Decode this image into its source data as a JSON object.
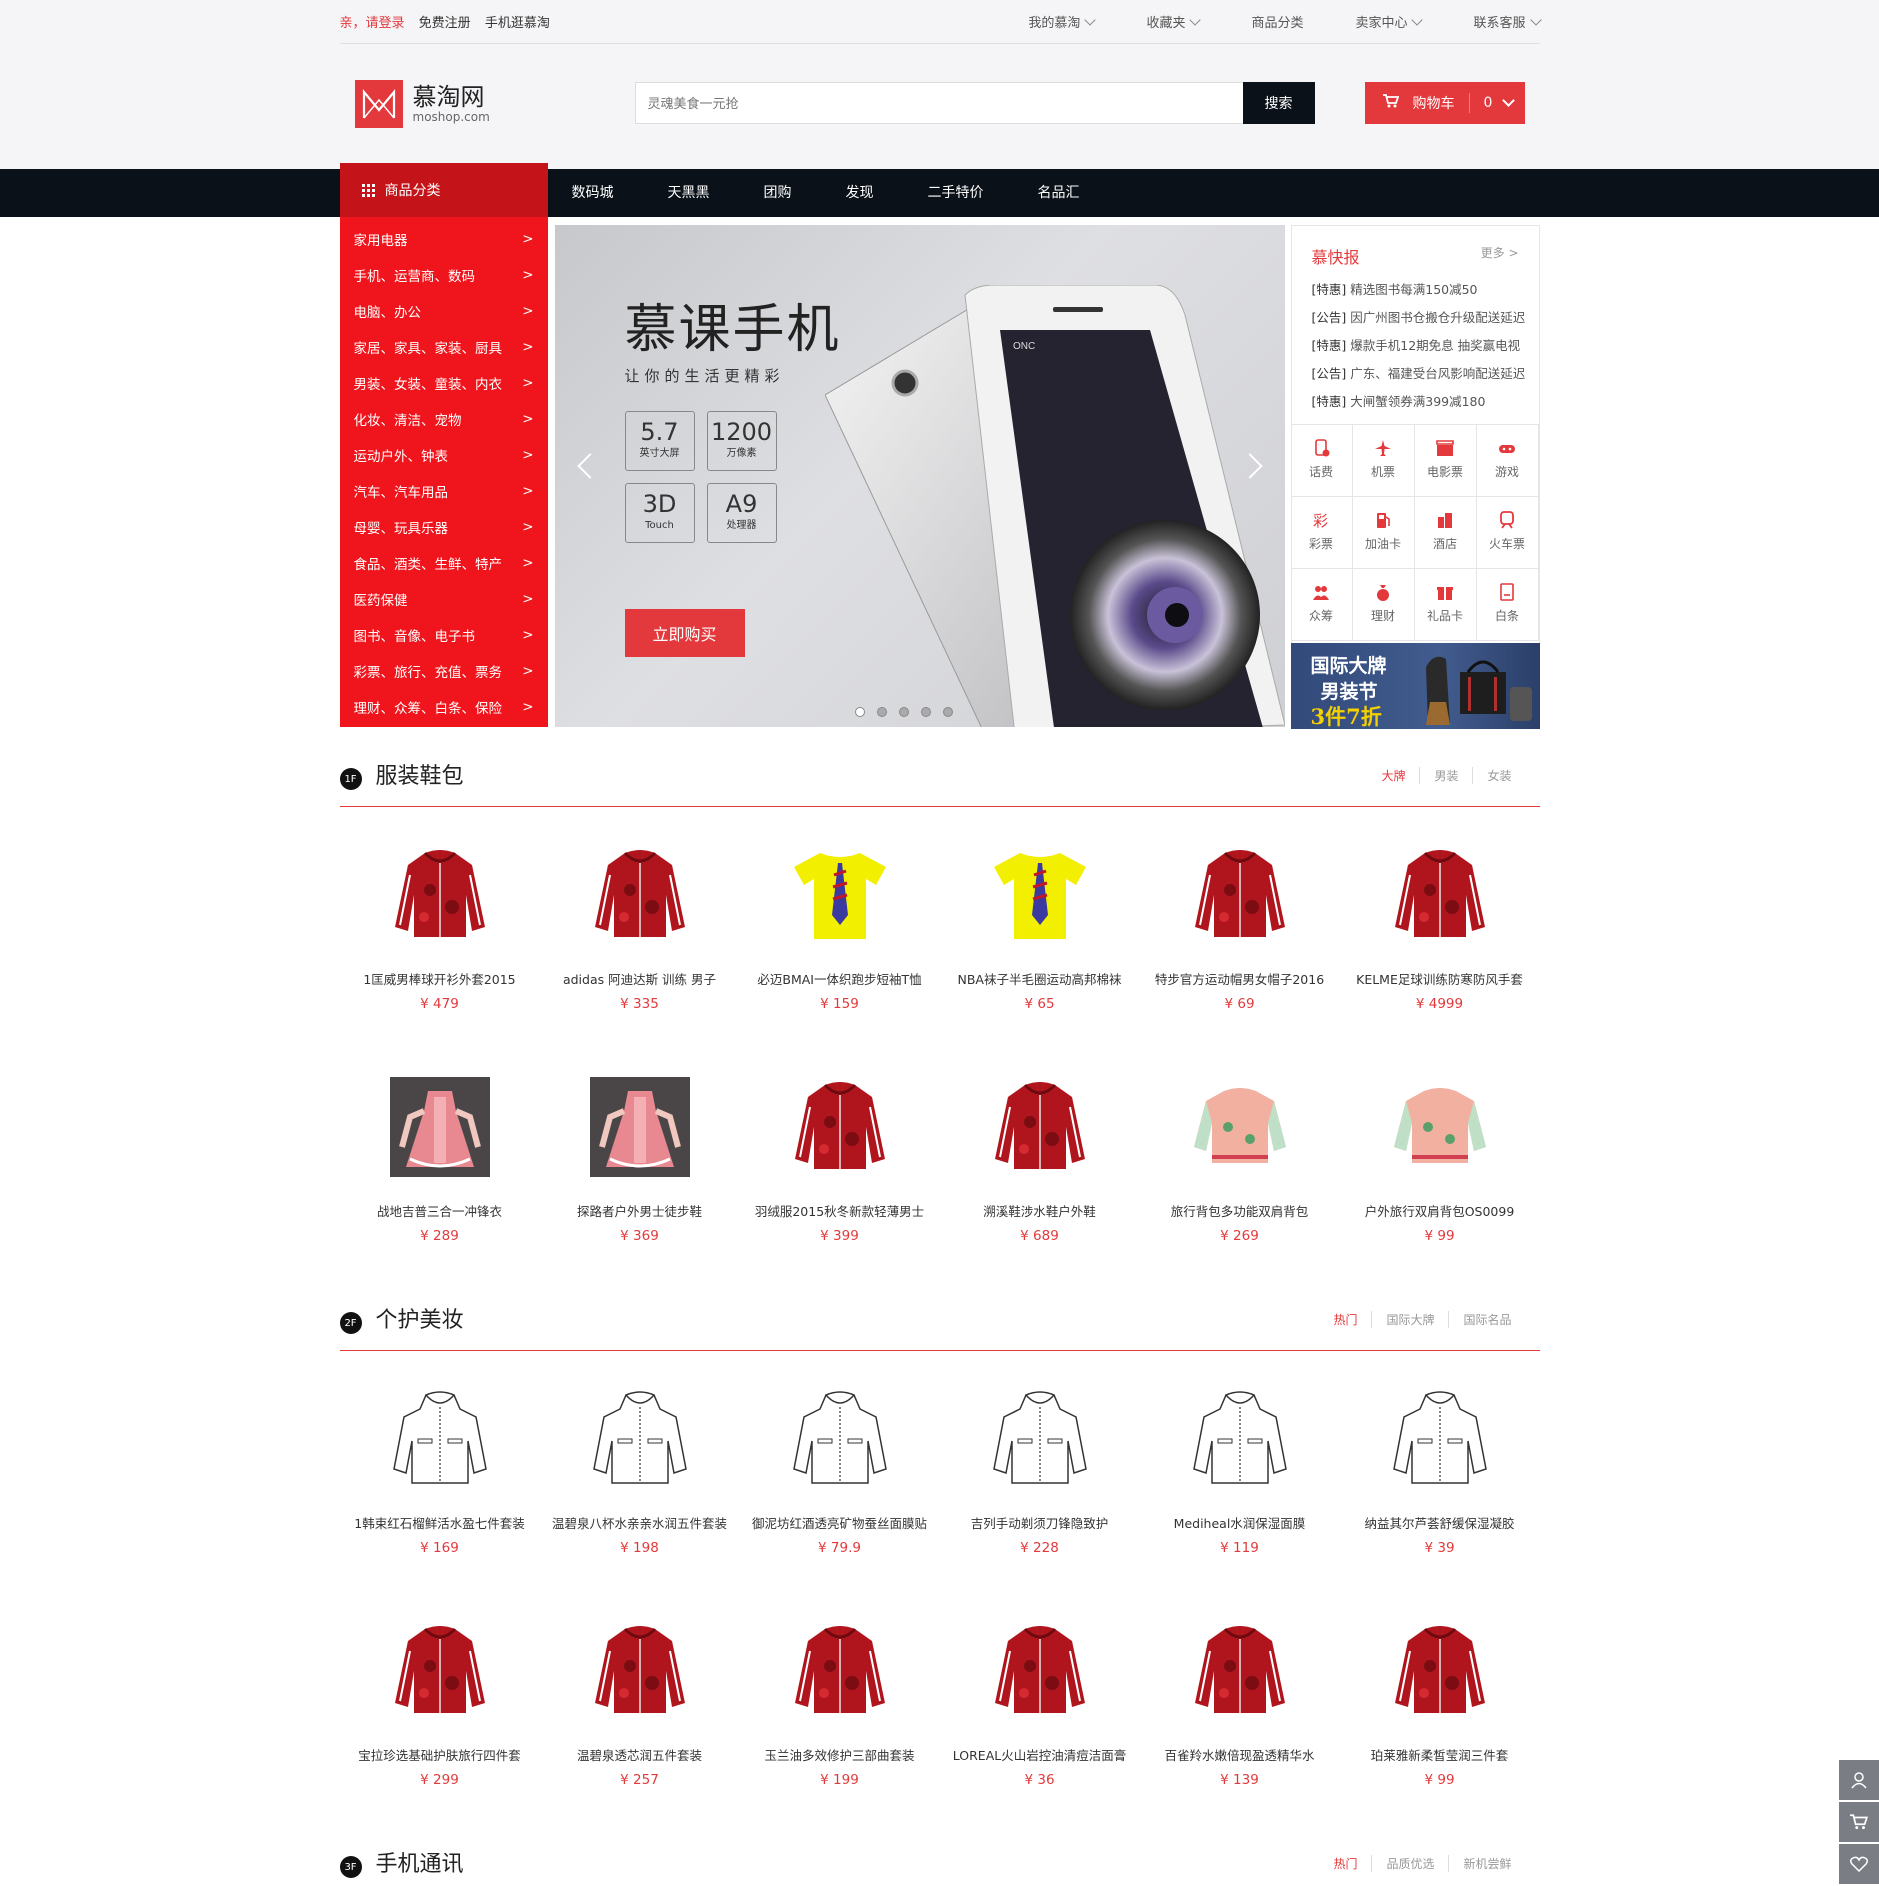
{
  "topbar": {
    "greeting": "亲，请登录",
    "register": "免费注册",
    "mobile": "手机逛慕淘",
    "links": [
      "我的慕淘",
      "收藏夹",
      "商品分类",
      "卖家中心",
      "联系客服"
    ]
  },
  "logo": {
    "cn": "慕淘网",
    "en": "moshop.com"
  },
  "search": {
    "placeholder": "灵魂美食一元抢",
    "button": "搜索"
  },
  "cart": {
    "label": "购物车",
    "count": "0"
  },
  "nav": {
    "category_label": "商品分类",
    "items": [
      "数码城",
      "天黑黑",
      "团购",
      "发现",
      "二手特价",
      "名品汇"
    ]
  },
  "categories": [
    "家用电器",
    "手机、运营商、数码",
    "电脑、办公",
    "家居、家具、家装、厨具",
    "男装、女装、童装、内衣",
    "化妆、清洁、宠物",
    "运动户外、钟表",
    "汽车、汽车用品",
    "母婴、玩具乐器",
    "食品、酒类、生鲜、特产",
    "医药保健",
    "图书、音像、电子书",
    "彩票、旅行、充值、票务",
    "理财、众筹、白条、保险"
  ],
  "category_arrow": ">",
  "banner": {
    "title": "慕课手机",
    "subtitle": "让你的生活更精彩",
    "specs": [
      {
        "big": "5.7",
        "small": "英寸大屏"
      },
      {
        "big": "1200",
        "small": "万像素"
      },
      {
        "big": "3D",
        "small": "Touch"
      },
      {
        "big": "A9",
        "small": "处理器"
      }
    ],
    "button": "立即购买",
    "phone_brand": "ONC",
    "active_dot": 1,
    "dot_count": 5
  },
  "news": {
    "title": "慕快报",
    "more": "更多 >",
    "items": [
      {
        "tag": "[特惠]",
        "text": "精选图书每满150减50"
      },
      {
        "tag": "[公告]",
        "text": "因广州图书仓搬仓升级配送延迟"
      },
      {
        "tag": "[特惠]",
        "text": "爆款手机12期免息 抽奖赢电视"
      },
      {
        "tag": "[公告]",
        "text": "广东、福建受台风影响配送延迟"
      },
      {
        "tag": "[特惠]",
        "text": "大闸蟹领券满399减180"
      }
    ]
  },
  "services": [
    {
      "label": "话费",
      "icon": "phone-icon"
    },
    {
      "label": "机票",
      "icon": "plane-icon"
    },
    {
      "label": "电影票",
      "icon": "clapper-icon"
    },
    {
      "label": "游戏",
      "icon": "gamepad-icon"
    },
    {
      "label": "彩票",
      "icon": "lottery-icon"
    },
    {
      "label": "加油卡",
      "icon": "fuel-icon"
    },
    {
      "label": "酒店",
      "icon": "hotel-icon"
    },
    {
      "label": "火车票",
      "icon": "train-icon"
    },
    {
      "label": "众筹",
      "icon": "crowd-icon"
    },
    {
      "label": "理财",
      "icon": "moneybag-icon"
    },
    {
      "label": "礼品卡",
      "icon": "gift-icon"
    },
    {
      "label": "白条",
      "icon": "note-icon"
    }
  ],
  "promo": {
    "line1": "国际大牌",
    "line2": "男装节",
    "line3": "3件7折"
  },
  "floors": [
    {
      "badge": "1F",
      "title": "服装鞋包",
      "tabs": [
        "大牌",
        "男装",
        "女装"
      ],
      "active_tab": 0,
      "products": [
        {
          "name": "1匡威男棒球开衫外套2015",
          "price": "¥ 479",
          "img": "red-jacket"
        },
        {
          "name": "adidas 阿迪达斯 训练 男子",
          "price": "¥ 335",
          "img": "red-jacket"
        },
        {
          "name": "必迈BMAI一体织跑步短袖T恤",
          "price": "¥ 159",
          "img": "yellow-tshirt"
        },
        {
          "name": "NBA袜子半毛圈运动高邦棉袜",
          "price": "¥ 65",
          "img": "yellow-tshirt"
        },
        {
          "name": "特步官方运动帽男女帽子2016",
          "price": "¥ 69",
          "img": "red-jacket"
        },
        {
          "name": "KELME足球训练防寒防风手套",
          "price": "¥ 4999",
          "img": "red-jacket"
        },
        {
          "name": "战地吉普三合一冲锋衣",
          "price": "¥ 289",
          "img": "pink-dress"
        },
        {
          "name": "探路者户外男士徒步鞋",
          "price": "¥ 369",
          "img": "pink-dress"
        },
        {
          "name": "羽绒服2015秋冬新款轻薄男士",
          "price": "¥ 399",
          "img": "red-jacket"
        },
        {
          "name": "溯溪鞋涉水鞋户外鞋",
          "price": "¥ 689",
          "img": "red-jacket"
        },
        {
          "name": "旅行背包多功能双肩背包",
          "price": "¥ 269",
          "img": "floral-jacket"
        },
        {
          "name": "户外旅行双肩背包OS0099",
          "price": "¥ 99",
          "img": "floral-jacket"
        }
      ]
    },
    {
      "badge": "2F",
      "title": "个护美妆",
      "tabs": [
        "热门",
        "国际大牌",
        "国际名品"
      ],
      "active_tab": 0,
      "products": [
        {
          "name": "1韩束红石榴鲜活水盈七件套装",
          "price": "¥ 169",
          "img": "sketch-jacket"
        },
        {
          "name": "温碧泉八杯水亲亲水润五件套装",
          "price": "¥ 198",
          "img": "sketch-jacket"
        },
        {
          "name": "御泥坊红酒透亮矿物蚕丝面膜贴",
          "price": "¥ 79.9",
          "img": "sketch-jacket"
        },
        {
          "name": "吉列手动剃须刀锋隐致护",
          "price": "¥ 228",
          "img": "sketch-jacket"
        },
        {
          "name": "Mediheal水润保湿面膜",
          "price": "¥ 119",
          "img": "sketch-jacket"
        },
        {
          "name": "纳益其尔芦荟舒缓保湿凝胶",
          "price": "¥ 39",
          "img": "sketch-jacket"
        },
        {
          "name": "宝拉珍选基础护肤旅行四件套",
          "price": "¥ 299",
          "img": "red-jacket"
        },
        {
          "name": "温碧泉透芯润五件套装",
          "price": "¥ 257",
          "img": "red-jacket"
        },
        {
          "name": "玉兰油多效修护三部曲套装",
          "price": "¥ 199",
          "img": "red-jacket"
        },
        {
          "name": "LOREAL火山岩控油清痘洁面膏",
          "price": "¥ 36",
          "img": "red-jacket"
        },
        {
          "name": "百雀羚水嫩倍现盈透精华水",
          "price": "¥ 139",
          "img": "red-jacket"
        },
        {
          "name": "珀莱雅新柔皙莹润三件套",
          "price": "¥ 99",
          "img": "red-jacket"
        }
      ]
    },
    {
      "badge": "3F",
      "title": "手机通讯",
      "tabs": [
        "热门",
        "品质优选",
        "新机尝鲜"
      ],
      "active_tab": 0,
      "products": []
    }
  ],
  "side_toolbar": [
    "user-icon",
    "cart-icon",
    "heart-icon"
  ],
  "colors": {
    "brand_red": "#e4393c",
    "nav_dark": "#0b1118",
    "category_red": "#f0151c"
  }
}
